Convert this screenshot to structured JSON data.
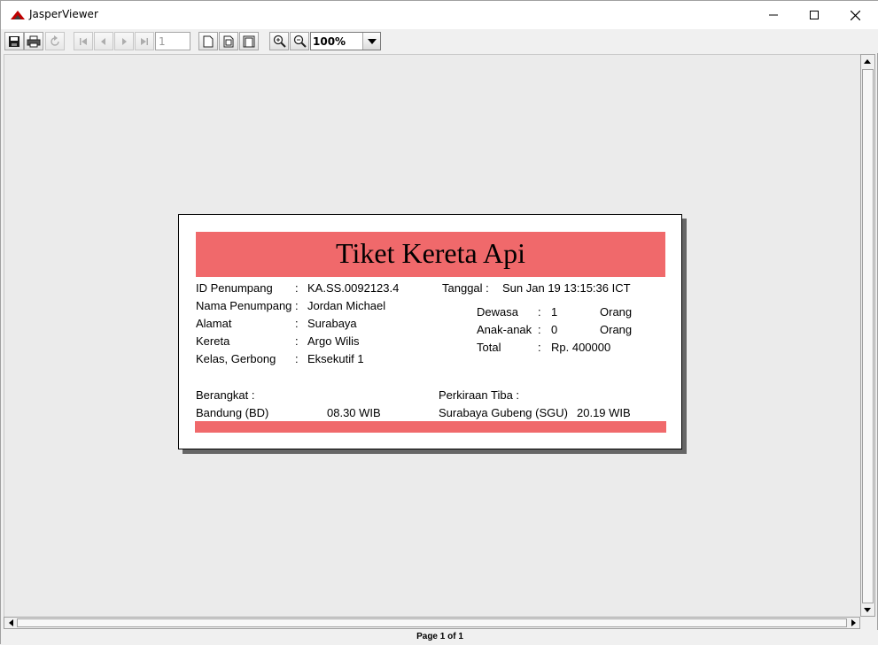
{
  "window": {
    "title": "JasperViewer"
  },
  "toolbar": {
    "page_number": "1",
    "zoom": "100%"
  },
  "status": {
    "text": "Page 1 of 1"
  },
  "ticket": {
    "title": "Tiket Kereta Api",
    "accent_color": "#f0696b",
    "passenger": {
      "id_label": "ID Penumpang",
      "id_value": "KA.SS.0092123.4",
      "name_label": "Nama Penumpang",
      "name_value": "Jordan Michael",
      "address_label": "Alamat",
      "address_value": "Surabaya",
      "train_label": "Kereta",
      "train_value": "Argo Wilis",
      "class_label": "Kelas, Gerbong",
      "class_value": "Eksekutif 1"
    },
    "date_label": "Tanggal :",
    "date_value": "Sun Jan 19 13:15:36 ICT",
    "fares": {
      "adult_label": "Dewasa",
      "adult_value": "1",
      "adult_unit": "Orang",
      "child_label": "Anak-anak",
      "child_value": "0",
      "child_unit": "Orang",
      "total_label": "Total",
      "total_value": "Rp. 400000"
    },
    "departure": {
      "label": "Berangkat :",
      "station": "Bandung (BD)",
      "time": "08.30 WIB"
    },
    "arrival": {
      "label": "Perkiraan Tiba :",
      "station": "Surabaya Gubeng (SGU)",
      "time": "20.19 WIB"
    }
  },
  "colon": ":"
}
